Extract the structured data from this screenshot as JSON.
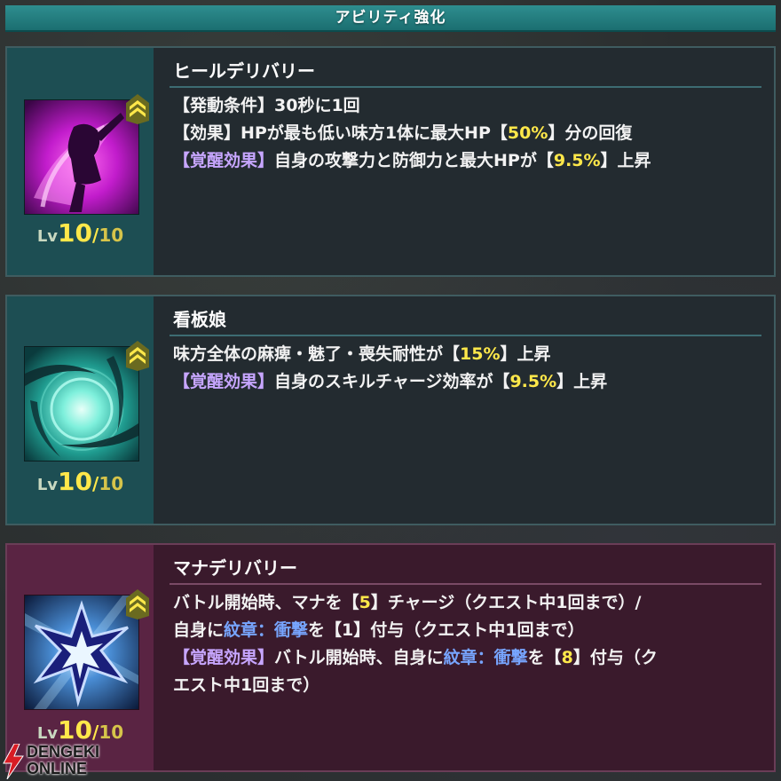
{
  "header": {
    "title": "アビリティ強化"
  },
  "abilities": [
    {
      "name": "ヒールデリバリー",
      "level": {
        "prefix": "Lv",
        "current": "10",
        "sep": "/",
        "max": "10"
      },
      "lines": [
        [
          {
            "text": "【発動条件】30秒に1回",
            "c": ""
          }
        ],
        [
          {
            "text": "【効果】HPが最も低い味方1体に最大HP【",
            "c": ""
          },
          {
            "text": "50%",
            "c": "y"
          },
          {
            "text": "】分の回復",
            "c": ""
          }
        ],
        [
          {
            "text": "【覚醒効果】",
            "c": "t"
          },
          {
            "text": "自身の攻撃力と防御力と最大HPが【",
            "c": ""
          },
          {
            "text": "9.5%",
            "c": "y"
          },
          {
            "text": "】上昇",
            "c": ""
          }
        ]
      ]
    },
    {
      "name": "看板娘",
      "level": {
        "prefix": "Lv",
        "current": "10",
        "sep": "/",
        "max": "10"
      },
      "lines": [
        [
          {
            "text": "味方全体の麻痺・魅了・喪失耐性が【",
            "c": ""
          },
          {
            "text": "15%",
            "c": "y"
          },
          {
            "text": "】上昇",
            "c": ""
          }
        ],
        [
          {
            "text": "【覚醒効果】",
            "c": "t"
          },
          {
            "text": "自身のスキルチャージ効率が【",
            "c": ""
          },
          {
            "text": "9.5%",
            "c": "y"
          },
          {
            "text": "】上昇",
            "c": ""
          }
        ]
      ]
    },
    {
      "name": "マナデリバリー",
      "level": {
        "prefix": "Lv",
        "current": "10",
        "sep": "/",
        "max": "10"
      },
      "lines": [
        [
          {
            "text": "バトル開始時、マナを【",
            "c": ""
          },
          {
            "text": "5",
            "c": "y"
          },
          {
            "text": "】チャージ（クエスト中1回まで）/",
            "c": ""
          }
        ],
        [
          {
            "text": "自身に",
            "c": ""
          },
          {
            "text": "紋章：衝撃",
            "c": "b"
          },
          {
            "text": "を【1】付与（クエスト中1回まで）",
            "c": ""
          }
        ],
        [
          {
            "text": "【覚醒効果】",
            "c": "t"
          },
          {
            "text": "バトル開始時、自身に",
            "c": ""
          },
          {
            "text": "紋章：衝撃",
            "c": "b"
          },
          {
            "text": "を【",
            "c": ""
          },
          {
            "text": "8",
            "c": "y"
          },
          {
            "text": "】付与（ク",
            "c": ""
          }
        ],
        [
          {
            "text": "エスト中1回まで）",
            "c": ""
          }
        ]
      ]
    }
  ],
  "watermark": {
    "line1": "DENGEKI",
    "line2": "ONLINE"
  },
  "colors": {
    "highlight": "#ffe84a",
    "awaken": "#c7a6ff",
    "crest": "#77a5ff",
    "header": "#1f7779"
  }
}
